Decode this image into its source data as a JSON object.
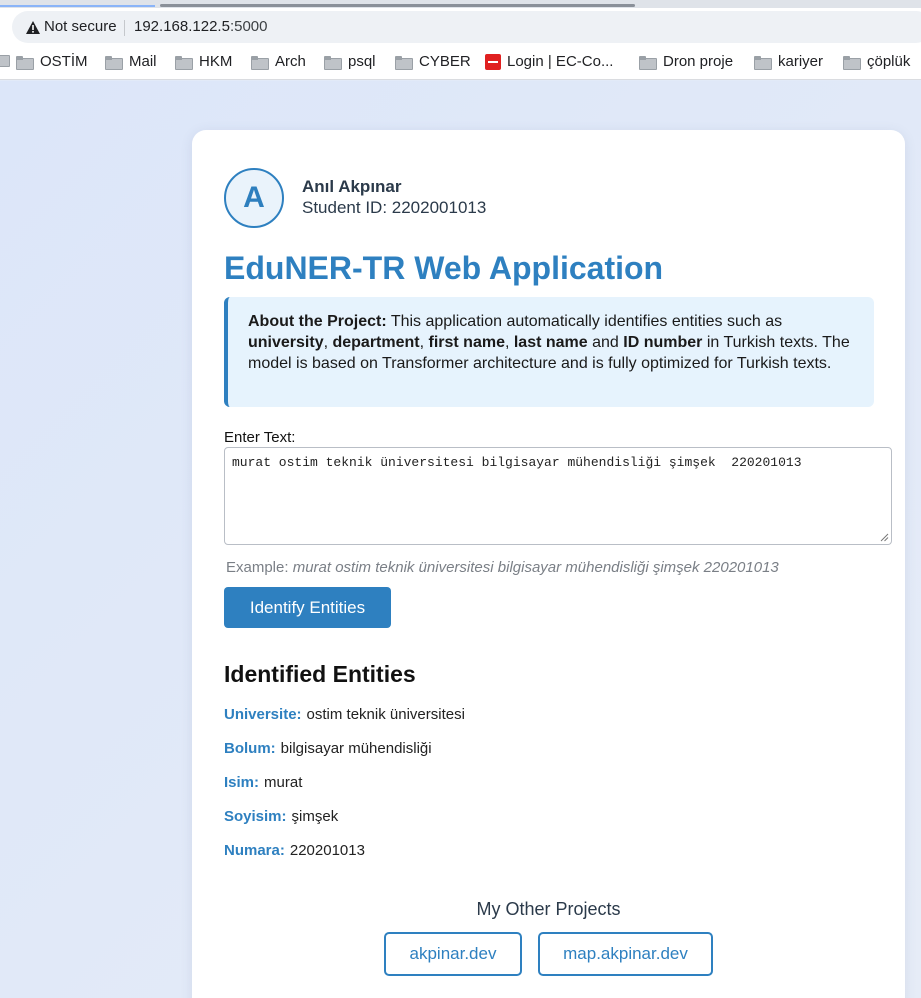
{
  "browser": {
    "security_label": "Not secure",
    "url_host": "192.168.122.5",
    "url_port": ":5000",
    "bookmarks": [
      "OSTİM",
      "Mail",
      "HKM",
      "Arch",
      "psql",
      "CYBER",
      "Login | EC-Co...",
      "Dron proje",
      "kariyer",
      "çöplük"
    ]
  },
  "header": {
    "avatar_letter": "A",
    "name": "Anıl Akpınar",
    "student_id": "Student ID: 2202001013"
  },
  "title": "EduNER-TR Web Application",
  "about": {
    "lead": "About the Project:",
    "t1": " This application automatically identifies entities such as ",
    "k1": "university",
    "t2": ", ",
    "k2": "department",
    "t3": ", ",
    "k3": "first name",
    "t4": ", ",
    "k4": "last name",
    "t5": " and ",
    "k5": "ID number",
    "t6": " in Turkish texts. The model is based on Transformer architecture and is fully optimized for Turkish texts."
  },
  "form": {
    "label": "Enter Text:",
    "value": "murat ostim teknik üniversitesi bilgisayar mühendisliği şimşek  220201013",
    "example_prefix": "Example: ",
    "example_text": "murat ostim teknik üniversitesi bilgisayar mühendisliği şimşek 220201013",
    "button": "Identify Entities"
  },
  "results": {
    "title": "Identified Entities",
    "items": [
      {
        "key": "Universite:",
        "value": "ostim teknik üniversitesi"
      },
      {
        "key": "Bolum:",
        "value": "bilgisayar mühendisliği"
      },
      {
        "key": "Isim:",
        "value": "murat"
      },
      {
        "key": "Soyisim:",
        "value": "şimşek"
      },
      {
        "key": "Numara:",
        "value": "220201013"
      }
    ]
  },
  "footer": {
    "title": "My Other Projects",
    "links": [
      "akpinar.dev",
      "map.akpinar.dev"
    ]
  },
  "colors": {
    "accent": "#2e80c0",
    "info_bg": "#e6f3fd"
  }
}
